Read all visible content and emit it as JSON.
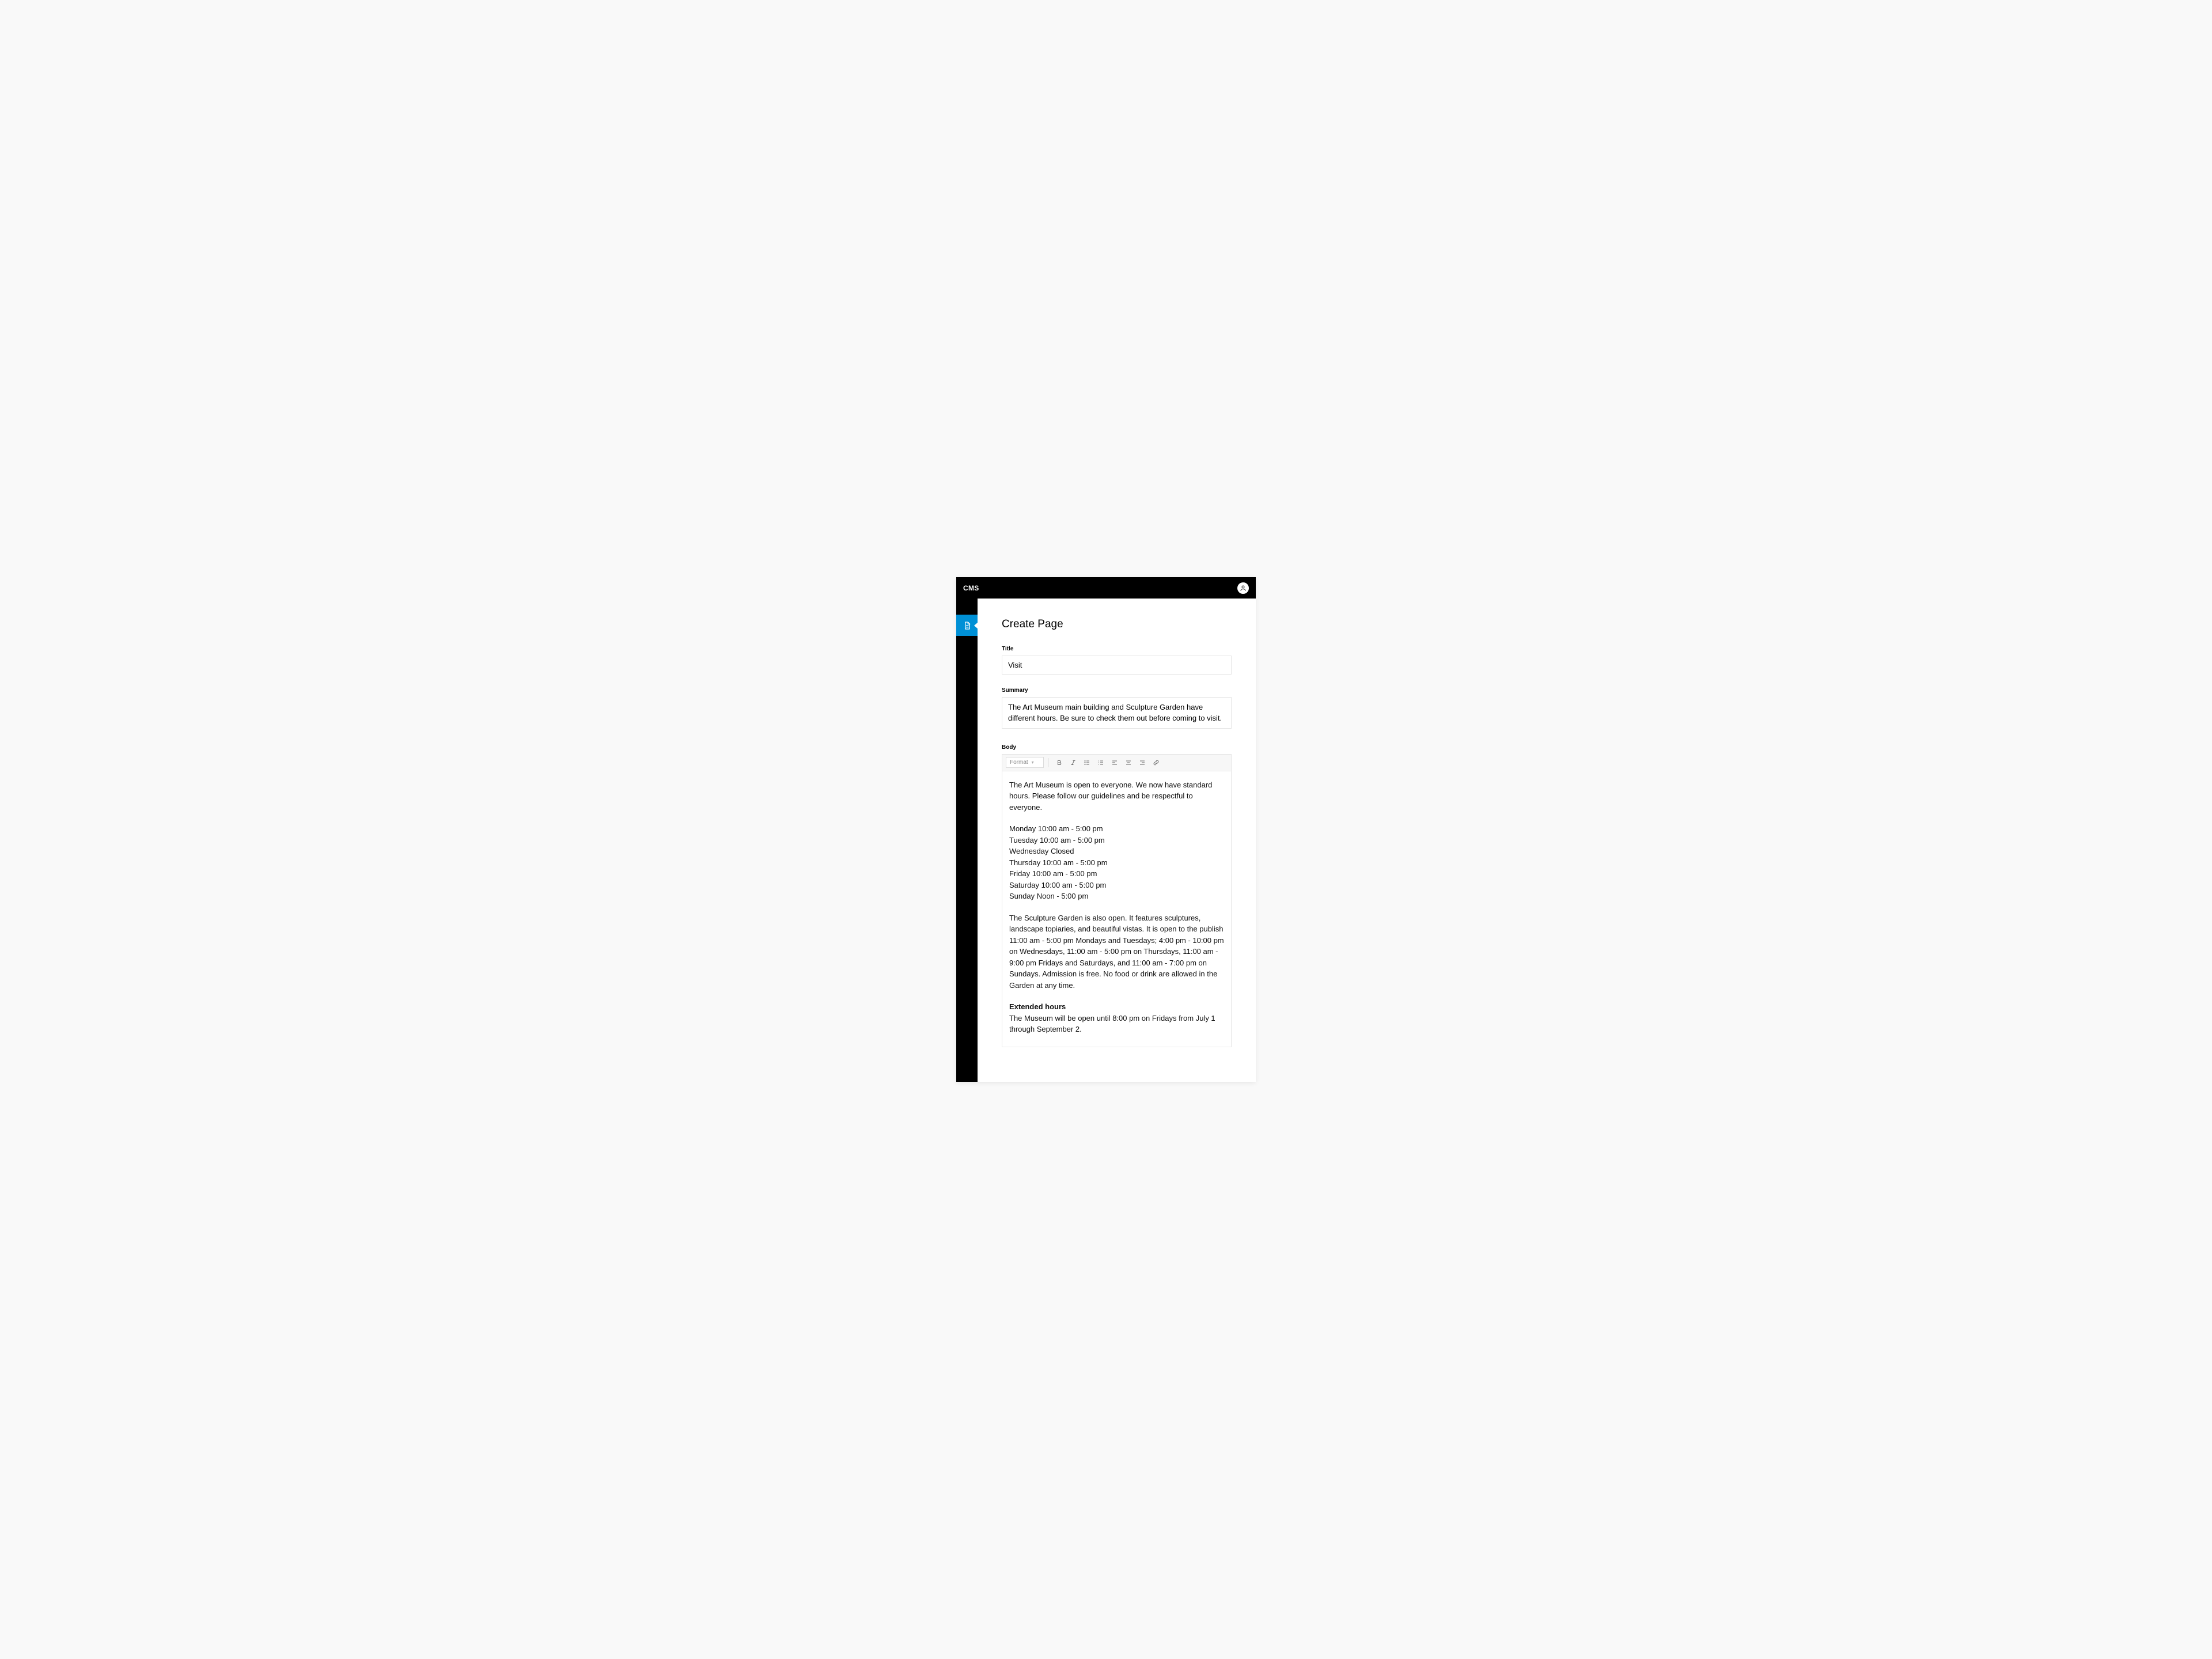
{
  "header": {
    "brand": "CMS"
  },
  "page": {
    "title": "Create Page"
  },
  "fields": {
    "title": {
      "label": "Title",
      "value": "Visit"
    },
    "summary": {
      "label": "Summary",
      "value": "The Art Museum main building and Sculpture Garden have different hours. Be sure to check them out before coming to visit."
    },
    "body": {
      "label": "Body"
    }
  },
  "toolbar": {
    "format_label": "Format"
  },
  "body_content": {
    "p1": "The Art Museum is open to everyone. We now have standard hours. Please follow our guidelines and be respectful to everyone.",
    "h_mon": "Monday 10:00 am - 5:00 pm",
    "h_tue": "Tuesday 10:00 am - 5:00 pm",
    "h_wed": "Wednesday Closed",
    "h_thu": "Thursday 10:00 am - 5:00 pm",
    "h_fri": "Friday 10:00 am - 5:00 pm",
    "h_sat": "Saturday 10:00 am - 5:00 pm",
    "h_sun": "Sunday Noon - 5:00 pm",
    "p2": "The Sculpture Garden is also open. It features sculptures, landscape topiaries, and beautiful vistas. It is open to the publish 11:00 am - 5:00 pm Mondays and Tuesdays; 4:00 pm - 10:00 pm on Wednesdays, 11:00 am - 5:00 pm on Thursdays, 11:00 am - 9:00 pm Fridays and Saturdays, and 11:00 am - 7:00 pm on Sundays. Admission is free. No food or drink are allowed in the Garden at any time.",
    "ext_heading": "Extended hours",
    "ext_text": "The Museum will be open until 8:00 pm on Fridays from July 1 through September 2."
  }
}
